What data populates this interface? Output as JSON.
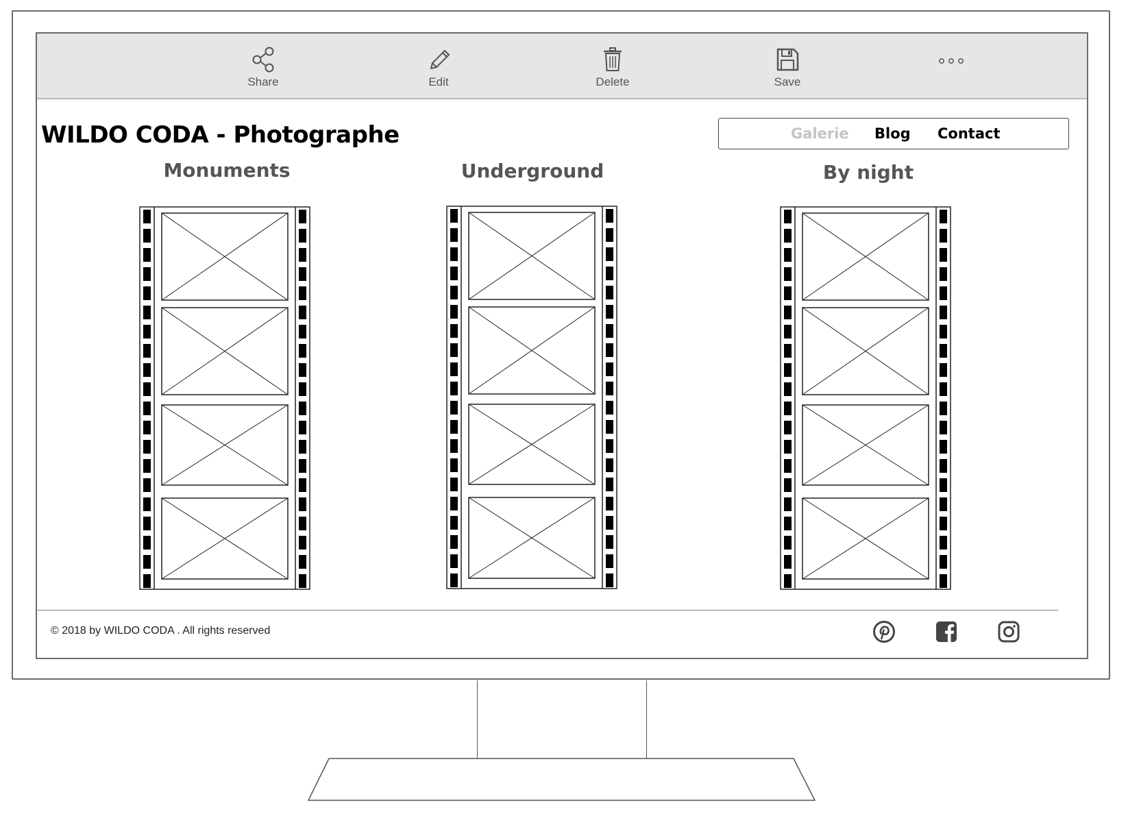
{
  "toolbar": {
    "share_label": "Share",
    "edit_label": "Edit",
    "delete_label": "Delete",
    "save_label": "Save",
    "more_icon": "more-dots-icon"
  },
  "site": {
    "title": "WILDO CODA - Photographe"
  },
  "nav": {
    "items": [
      {
        "label": "Galerie",
        "active": true
      },
      {
        "label": "Blog",
        "active": false
      },
      {
        "label": "Contact",
        "active": false
      }
    ],
    "active_color": "#c4c4c4"
  },
  "galleries": [
    {
      "title": "Monuments"
    },
    {
      "title": "Underground"
    },
    {
      "title": "By night"
    }
  ],
  "footer": {
    "copyright": "© 2018 by WILDO CODA . All rights reserved",
    "social": [
      "pinterest-icon",
      "facebook-icon",
      "instagram-icon"
    ]
  },
  "colors": {
    "toolbar_bg": "#e6e6e6",
    "heading_gray": "#555555",
    "icon_dark": "#444444"
  }
}
